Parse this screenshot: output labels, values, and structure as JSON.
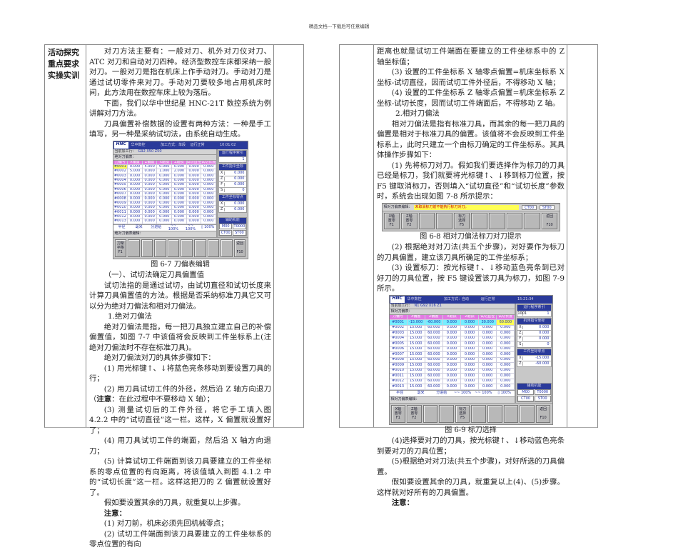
{
  "header": "精品文档---下载后可任意编辑",
  "left_labels": [
    "活动探究",
    "重点要求",
    "实操实训"
  ],
  "left_paragraphs": [
    {
      "cls": "ind",
      "text": "对刀方法主要有：一般对刀、机外对刀仪对刀、ATC 对刀和自动对刀四种。经济型数控车床都采纳一般对刀。一般对刀是指在机床上作手动对刀。手动对刀是通过试切零件来对刀。手动对刀要较多地占用机床时间，此方法用在数控车床上较为落后。"
    },
    {
      "cls": "ind",
      "text": "下面，我们以华中世纪星 HNC-21T 数控系统为例讲解对刀方法。"
    },
    {
      "cls": "ind",
      "text": "刀具偏置补偿数据的设置有两种方法：一种是手工填写，另一种是采纳试切法，由系统自动生成。"
    },
    {
      "fig": "fig67"
    },
    {
      "cls": "cap",
      "text": "图 6-7 刀偏表编辑"
    },
    {
      "cls": "ind",
      "text": "（一）、试切法确定刀具偏置值"
    },
    {
      "cls": "ind",
      "text": "试切法指的是通过试切，由试切直径和试切长度来计算刀具偏置值的方法。根据是否采纳标准刀具它又可以分为绝对刀偏法和相对刀偏法。"
    },
    {
      "cls": "ind3",
      "text": "1.绝对刀偏法"
    },
    {
      "cls": "ind",
      "text": "绝对刀偏法是指，每一把刀具独立建立自己的补偿偏置值，如图 7-7 中该值将会反映到工件坐标系上(注绝对刀偏法时不存在标准刀具)。"
    },
    {
      "cls": "ind",
      "text": "绝对刀偏法对刀的具体步骤如下："
    },
    {
      "cls": "ind",
      "text": "(1) 用光标键↑、↓将蓝色亮条移动到要设置刀具的行；"
    },
    {
      "cls": "ind",
      "parts": [
        "(2) 用刀具试切工件的外径，然后沿 Z 轴方向退刀（",
        "注意",
        "：在此过程中不要移动 X 轴）；"
      ]
    },
    {
      "cls": "ind",
      "text": "(3) 测量试切后的工件外径，将它手工填入图 4.2.2 中的“试切直径”这一栏。这样，X 偏置就设置好了；"
    },
    {
      "cls": "ind",
      "text": "(4) 用刀具试切工件的端面，然后沿 X 轴方向退刀；"
    },
    {
      "cls": "ind",
      "text": "(5) 计算试切工件端面到该刀具要建立的工件坐标系的零点位置的有向距离，将该值填入到图 4.1.2 中的“试切长度”这一栏。这样这把刀的 Z 偏置就设置好了。"
    },
    {
      "cls": "ind",
      "text": "假如要设置其余的刀具，就重复以上步骤。"
    },
    {
      "cls": "ind",
      "bold": "注意："
    },
    {
      "cls": "ind",
      "text": "(1) 对刀前，机床必须先回机械零点；"
    },
    {
      "cls": "ind",
      "text": "(2) 试切工件端面到该刀具要建立的工件坐标系的零点位置的有向"
    }
  ],
  "right_paragraphs": [
    {
      "cls": "",
      "text": "距离也就是试切工件端面在要建立的工件坐标系中的 Z 轴坐标值；"
    },
    {
      "cls": "ind",
      "text": "(3) 设置的工件坐标系 X 轴零点偏置=机床坐标系 X 坐标-试切直径，因而试切工件外径后，不得移动 X 轴；"
    },
    {
      "cls": "ind",
      "text": "(4) 设置的工件坐标系 Z 轴零点偏置=机床坐标系 Z 坐标-试切长度，因而试切工件端面后，不得移动 Z 轴。"
    },
    {
      "cls": "ind3",
      "text": "2.相对刀偏法"
    },
    {
      "cls": "ind",
      "text": "相对刀偏法是指有标准刀具，而其余的每一把刀具的偏置是相对于标准刀具的偏置。该值将不会反映到工件坐标系上，此时只建立一个由标刀确定的工件坐标系。其具体操作步骤如下："
    },
    {
      "cls": "ind",
      "text": "(1) 先将标刀对刀。假如我们要选择作为标刀的刀具已经是标刀，我们就要将光标键↑、↓移到标刀位置，按 F5 键取消标刀，否则填入“试切直径”和“试切长度”参数时，系统会出现如图 7-8 所示提示："
    },
    {
      "fig": "fig68"
    },
    {
      "cls": "cap",
      "text": "图 6-8 相对刀偏法标刀对刀提示"
    },
    {
      "cls": "ind",
      "text": "(2) 根据绝对对刀法(共五个步骤)，对好要作为标刀的刀具偏置，建立该刀具所确定的工件坐标系；"
    },
    {
      "cls": "ind",
      "text": "(3) 设置标刀：按光标键↑、↓移动蓝色亮条到已对好刀的刀具位置，按 F5 键设置该刀具为标刀，如图 7-9 所示。"
    },
    {
      "fig": "fig69"
    },
    {
      "cls": "cap",
      "text": "图 6-9 标刀选择"
    },
    {
      "cls": "ind",
      "text": "(4)选择要对刀的刀具，按光标键↑、↓移动蓝色亮条到要对刀的刀具位置；"
    },
    {
      "cls": "ind",
      "text": "(5)根据绝对对刀法(共五个步骤)，对好所选的刀具偏置。"
    },
    {
      "cls": "ind",
      "text": "假如要设置其余的刀具，就重复以上(4)、(5)步骤。这样就对好所有的刀具偏置。"
    },
    {
      "cls": "ind",
      "bold": "注意："
    }
  ],
  "figures": {
    "fig67": {
      "top": [
        "HNC",
        "华中数控",
        "加工方式：单段",
        "运行正常",
        "10:01:02"
      ],
      "program_label": "当前加工行：",
      "program": "G92 X50 Z50",
      "table_title": "绝对刀偏表：",
      "headers": [
        "刀偏号",
        "X偏置",
        "Z偏置",
        "X磨损",
        "Z磨损",
        "试切直径",
        "试切长度"
      ],
      "rows": [
        [
          "#0001",
          "0.000",
          "5.000",
          "0.000",
          "0.000",
          "0.000",
          "0.000"
        ],
        [
          "#0002",
          "5.000",
          "0.000",
          "1.000",
          "2.000",
          "0.000",
          "0.000"
        ],
        [
          "#0003",
          "0.000",
          "0.000",
          "0.000",
          "0.000",
          "0.000",
          "0.000"
        ],
        [
          "#0004",
          "0.000",
          "0.000",
          "0.000",
          "0.000",
          "0.000",
          "0.000"
        ],
        [
          "#0005",
          "0.000",
          "0.000",
          "0.000",
          "0.000",
          "0.000",
          "0.000"
        ],
        [
          "#0006",
          "0.000",
          "0.000",
          "0.000",
          "0.000",
          "0.000",
          "0.000"
        ],
        [
          "#0007",
          "0.000",
          "0.000",
          "0.000",
          "0.000",
          "0.000",
          "0.000"
        ],
        [
          "#0008",
          "0.000",
          "0.000",
          "0.000",
          "0.000",
          "0.000",
          "0.000"
        ],
        [
          "#0009",
          "0.000",
          "0.000",
          "0.000",
          "0.000",
          "0.000",
          "0.000"
        ],
        [
          "#0010",
          "0.000",
          "0.000",
          "0.000",
          "0.000",
          "0.000",
          "0.000"
        ],
        [
          "#0011",
          "0.000",
          "0.000",
          "0.000",
          "0.000",
          "0.000",
          "0.000"
        ],
        [
          "#0012",
          "0.000",
          "0.000",
          "0.000",
          "0.000",
          "0.000",
          "0.000"
        ],
        [
          "#0013",
          "0.000",
          "0.000",
          "0.000",
          "0.000",
          "0.000",
          "0.000"
        ]
      ],
      "status": [
        "半径",
        "毫米",
        "分进给",
        "~~ 100%",
        "~~ 100%",
        "▯ 100%"
      ],
      "edit_label": "绝对刀偏表编辑：",
      "side": [
        {
          "title": "运行程序索引",
          "rows": [
            [
              "",
              "1"
            ]
          ]
        },
        {
          "title": "工件指令坐标",
          "rows": [
            [
              "X",
              "0.000"
            ],
            [
              "Z",
              "0.000"
            ],
            [
              "F",
              "0.000"
            ],
            [
              "S",
              "0"
            ]
          ]
        },
        {
          "title": "工件坐标零点",
          "rows": [
            [
              "X",
              "0.000"
            ],
            [
              "Z",
              "0.000"
            ]
          ]
        }
      ],
      "aux_title": "辅助机能",
      "aux": [
        "M00",
        "T0000",
        "CT00",
        "ST00"
      ],
      "fkeys": [
        "刀架\n平移\nF1",
        "",
        "",
        "",
        "",
        "",
        "",
        "",
        "",
        "返回\n\nF10"
      ]
    },
    "fig68": {
      "edit_label": "相对刀偏表编辑：",
      "message": "未取消标刀前不能执行标刀对刀。",
      "ct": "CT00",
      "st": "ST00",
      "fkeys": [
        "X轴\n置零\nF1",
        "Z轴\n置零\nF2",
        "",
        "",
        "标刀\n选择\nF5",
        "",
        "",
        "",
        "",
        "返回\n\nF10"
      ]
    },
    "fig69": {
      "top": [
        "HNC",
        "华中数控",
        "加工方式：自动",
        "运行正常",
        "15:21:34"
      ],
      "program_label": "当前加工行：",
      "program": "N1 G92 X16 Z1",
      "table_title": "相对刀偏表：",
      "headers": [
        "刀偏号",
        "X偏置",
        "Z偏置",
        "X磨损",
        "Z磨损",
        "试切直径",
        "试切长度"
      ],
      "rows": [
        [
          "#0001",
          "-15.000",
          "-60.000",
          "0.000",
          "0.000",
          "30.000",
          "60.000"
        ],
        [
          "#0002",
          "15.000",
          "60.000",
          "0.000",
          "0.000",
          "0.000",
          "0.000"
        ],
        [
          "#0003",
          "15.000",
          "60.000",
          "0.000",
          "0.000",
          "0.000",
          "0.000"
        ],
        [
          "#0004",
          "15.000",
          "60.000",
          "0.000",
          "0.000",
          "0.000",
          "0.000"
        ],
        [
          "#0005",
          "15.000",
          "60.000",
          "0.000",
          "0.000",
          "0.000",
          "0.000"
        ],
        [
          "#0006",
          "15.000",
          "60.000",
          "0.000",
          "0.000",
          "0.000",
          "0.000"
        ],
        [
          "#0007",
          "15.000",
          "60.000",
          "0.000",
          "0.000",
          "0.000",
          "0.000"
        ],
        [
          "#0008",
          "15.000",
          "60.000",
          "0.000",
          "0.000",
          "0.000",
          "0.000"
        ],
        [
          "#0009",
          "15.000",
          "60.000",
          "0.000",
          "0.000",
          "0.000",
          "0.000"
        ],
        [
          "#0010",
          "15.000",
          "60.000",
          "0.000",
          "0.000",
          "0.000",
          "0.000"
        ],
        [
          "#0011",
          "15.000",
          "60.000",
          "0.000",
          "0.000",
          "0.000",
          "0.000"
        ],
        [
          "#0012",
          "15.000",
          "60.000",
          "0.000",
          "0.000",
          "0.000",
          "0.000"
        ],
        [
          "#0013",
          "15.000",
          "60.000",
          "0.000",
          "0.000",
          "0.000",
          "0.000"
        ]
      ],
      "status": [
        "半径",
        "毫米",
        "分进给",
        "~~ 100%",
        "~~ 100%",
        "▯ 100%"
      ],
      "edit_label": "相对刀偏表编辑：",
      "side": [
        {
          "title": "运行程序索引",
          "rows": [
            [
              "1001",
              "1"
            ]
          ]
        },
        {
          "title": "机床指令坐标",
          "rows": [
            [
              "X",
              "0.000"
            ],
            [
              "Z",
              "0.000"
            ],
            [
              "F",
              "0.000"
            ],
            [
              "S",
              "0"
            ]
          ]
        },
        {
          "title": "工件坐标零点",
          "rows": [
            [
              "X",
              "-15.000"
            ],
            [
              "Z",
              "-60.000"
            ]
          ]
        }
      ],
      "aux_title": "辅助机能",
      "aux": [
        "M00",
        "T0000",
        "CT00",
        "ST00"
      ],
      "fkeys": [
        "X轴\n置零\nF1",
        "Z轴\n置零\nF2",
        "",
        "",
        "标刀\n选择\nF5",
        "",
        "",
        "",
        "",
        "返回\n\nF10"
      ]
    }
  }
}
